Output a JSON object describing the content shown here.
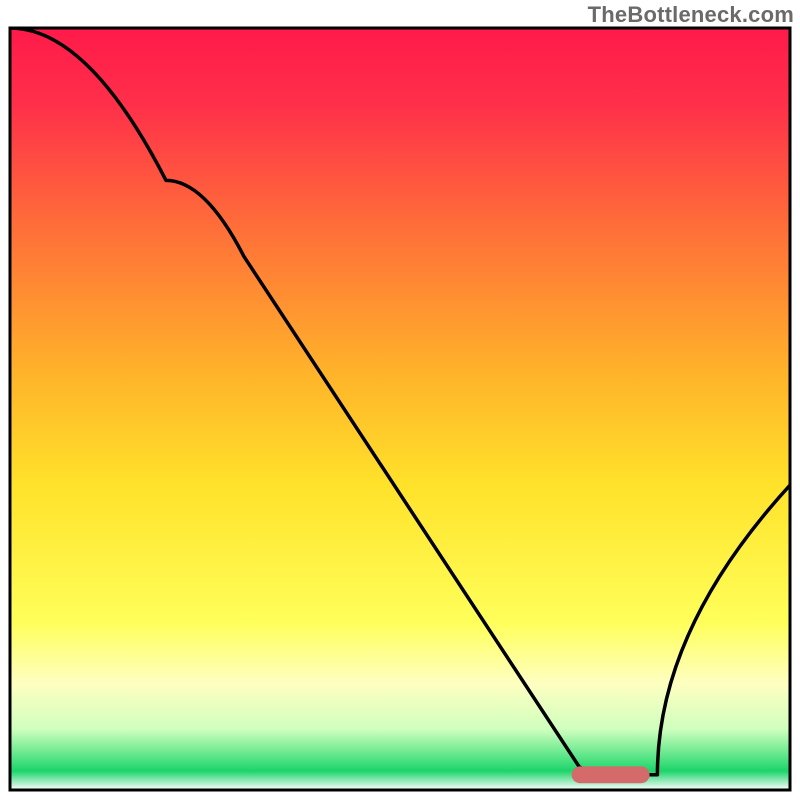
{
  "watermark": "TheBottleneck.com",
  "chart_data": {
    "type": "line",
    "title": "",
    "xlabel": "",
    "ylabel": "",
    "xlim": [
      0,
      100
    ],
    "ylim": [
      0,
      100
    ],
    "marker": {
      "x": 77,
      "y": 2,
      "width": 10,
      "height": 2.2,
      "color": "#d46a6a"
    },
    "curve": [
      {
        "x": 0,
        "y": 100
      },
      {
        "x": 20,
        "y": 80
      },
      {
        "x": 30,
        "y": 70
      },
      {
        "x": 73,
        "y": 3
      },
      {
        "x": 77,
        "y": 2
      },
      {
        "x": 83,
        "y": 2
      },
      {
        "x": 100,
        "y": 40
      }
    ],
    "gradient_stops": [
      {
        "offset": 0.0,
        "color": "#ff1a4a"
      },
      {
        "offset": 0.1,
        "color": "#ff2f4a"
      },
      {
        "offset": 0.25,
        "color": "#ff6a3a"
      },
      {
        "offset": 0.45,
        "color": "#ffb22a"
      },
      {
        "offset": 0.6,
        "color": "#ffe22a"
      },
      {
        "offset": 0.78,
        "color": "#ffff5a"
      },
      {
        "offset": 0.86,
        "color": "#feffc0"
      },
      {
        "offset": 0.92,
        "color": "#d0ffbf"
      },
      {
        "offset": 0.955,
        "color": "#5fe68a"
      },
      {
        "offset": 0.975,
        "color": "#1cd46a"
      },
      {
        "offset": 1.0,
        "color": "#ffffff"
      }
    ],
    "border": {
      "color": "#000000",
      "width": 3
    }
  }
}
